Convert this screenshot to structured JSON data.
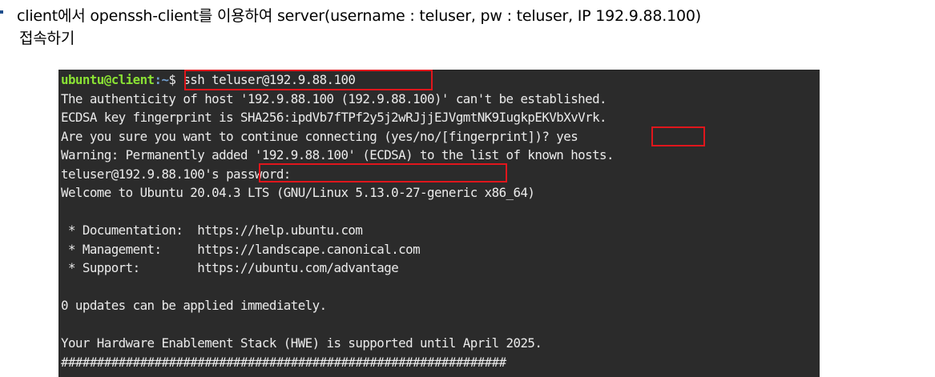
{
  "heading": {
    "line1": "client에서 openssh-client를 이용하여 server(username : teluser, pw : teluser, IP 192.9.88.100)",
    "line2": "접속하기"
  },
  "terminal": {
    "prompt_user_host": "ubuntu@client",
    "prompt_path": ":~",
    "prompt_symbol": "$ ",
    "command": "ssh teluser@192.9.88.100",
    "authenticity": "The authenticity of host '192.9.88.100 (192.9.88.100)' can't be established.",
    "fingerprint": "ECDSA key fingerprint is SHA256:ipdVb7fTPf2y5j2wRJjjEJVgmtNK9IugkpEKVbXvVrk.",
    "confirm_prompt": "Are you sure you want to continue connecting (yes/no/[fingerprint])? ",
    "confirm_answer": "yes",
    "warning": "Warning: Permanently added '192.9.88.100' (ECDSA) to the list of known hosts.",
    "password_prefix": "teluser@192.9.88.100's ",
    "password_label": "password:",
    "welcome": "Welcome to Ubuntu 20.04.3 LTS (GNU/Linux 5.13.0-27-generic x86_64)",
    "links": [
      {
        "label": " * Documentation:  ",
        "url": "https://help.ubuntu.com"
      },
      {
        "label": " * Management:     ",
        "url": "https://landscape.canonical.com"
      },
      {
        "label": " * Support:        ",
        "url": "https://ubuntu.com/advantage"
      }
    ],
    "updates": "0 updates can be applied immediately.",
    "hwe": "Your Hardware Enablement Stack (HWE) is supported until April 2025.",
    "hash_rule": "##############################################################"
  },
  "colors": {
    "terminal_bg": "#2b2b2b",
    "terminal_fg": "#ebebeb",
    "prompt_user": "#8ae234",
    "prompt_path": "#729fcf",
    "highlight_box": "#e0161c"
  }
}
